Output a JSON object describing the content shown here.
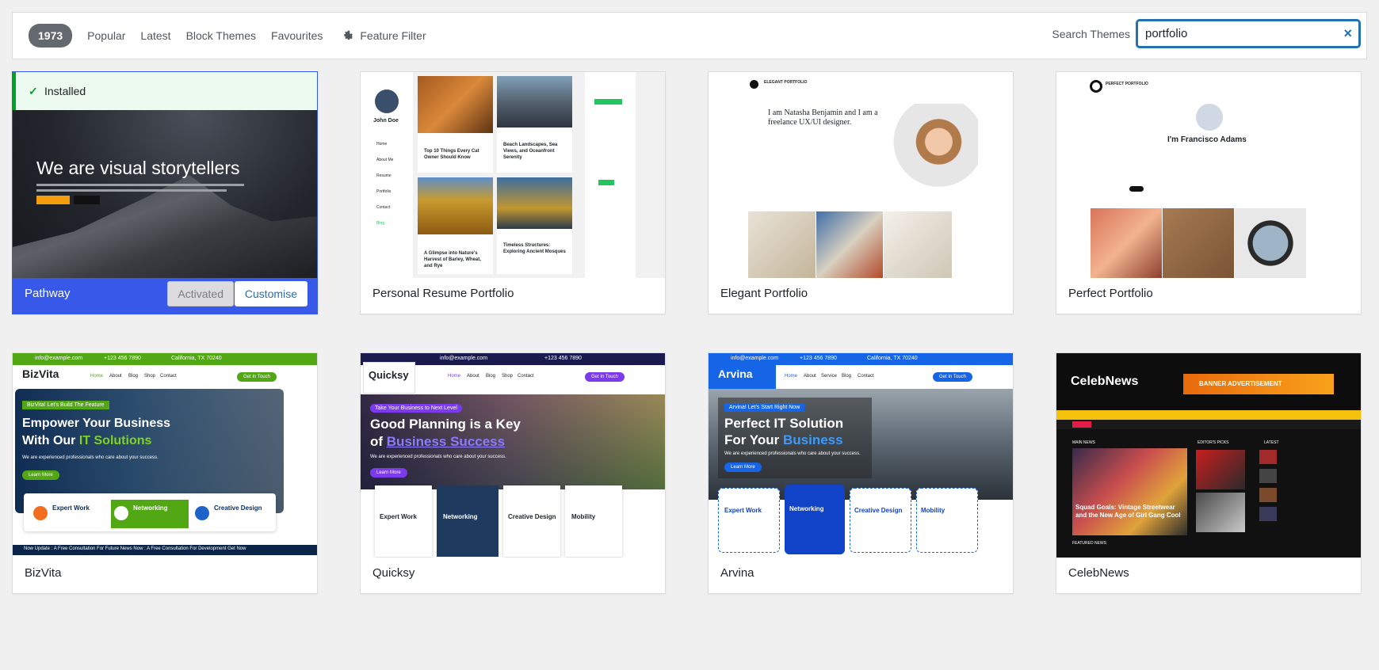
{
  "filter": {
    "count": "1973",
    "tabs": [
      "Popular",
      "Latest",
      "Block Themes",
      "Favourites"
    ],
    "feature_filter": "Feature Filter",
    "search_label": "Search Themes",
    "search_value": "portfolio",
    "clear_icon": "×"
  },
  "themes": [
    {
      "name": "Pathway",
      "installed_label": "Installed",
      "activated_label": "Activated",
      "customise_label": "Customise",
      "preview_headline": "We are visual storytellers"
    },
    {
      "name": "Personal Resume Portfolio",
      "preview": {
        "person": "John Doe",
        "nav": [
          "Home",
          "About Me",
          "Resume",
          "Portfolio",
          "Contact",
          "Blog"
        ],
        "posts": [
          "Top 10 Things Every Cat Owner Should Know",
          "Beach Landscapes, Sea Views, and Oceanfront Serenity",
          "A Glimpse into Nature's Harvest of Barley, Wheat, and Rye",
          "Timeless Structures: Exploring Ancient Mosques"
        ]
      }
    },
    {
      "name": "Elegant Portfolio",
      "preview": {
        "logo": "ELEGANT PORTFOLIO",
        "headline": "I am Natasha Benjamin and I am a freelance UX/UI designer."
      }
    },
    {
      "name": "Perfect Portfolio",
      "preview": {
        "logo": "PERFECT PORTFOLIO",
        "headline": "I'm Francisco Adams"
      }
    },
    {
      "name": "BizVita",
      "preview": {
        "email": "info@example.com",
        "phone": "+123 456 7890",
        "location": "California, TX 70240",
        "logo": "BizVita",
        "nav": [
          "Home",
          "About",
          "Blog",
          "Shop",
          "Contact"
        ],
        "cta": "Get In Touch",
        "tagline": "BizVita!  Let's Build The Feature",
        "headline_1": "Empower Your Business",
        "headline_2": "With Our ",
        "headline_accent": "IT Solutions",
        "sub": "We are experienced professionals who care about your success.",
        "learn": "Learn More",
        "features": [
          "Expert Work",
          "Networking",
          "Creative Design"
        ],
        "ticker": "Now Update : A Free Consultation For Future   News Now : A Free Consultation For Development   Get Now"
      }
    },
    {
      "name": "Quicksy",
      "preview": {
        "email": "info@example.com",
        "phone": "+123 456 7890",
        "logo": "Quicksy",
        "nav": [
          "Home",
          "About",
          "Blog",
          "Shop",
          "Contact"
        ],
        "cta": "Get In Touch",
        "tagline": "Take Your Business to Next Level",
        "headline_1": "Good Planning is a Key",
        "headline_2": "of ",
        "headline_accent": "Business Success",
        "sub": "We are experienced professionals who care about your success.",
        "learn": "Learn More",
        "features": [
          "Expert Work",
          "Networking",
          "Creative Design",
          "Mobility"
        ]
      }
    },
    {
      "name": "Arvina",
      "preview": {
        "email": "info@example.com",
        "phone": "+123 456 7890",
        "location": "California, TX 70240",
        "logo": "Arvina",
        "nav": [
          "Home",
          "About",
          "Service",
          "Blog",
          "Contact"
        ],
        "cta": "Get In Touch",
        "tagline": "Arvina!  Let's Start Right Now",
        "headline_1": "Perfect IT Solution",
        "headline_2": "For Your ",
        "headline_accent": "Business",
        "sub": "We are experienced professionals who care about your success.",
        "learn": "Learn More",
        "features": [
          "Expert Work",
          "Networking",
          "Creative Design",
          "Mobility"
        ]
      }
    },
    {
      "name": "CelebNews",
      "preview": {
        "logo": "CelebNews",
        "banner": "BANNER ADVERTISEMENT",
        "main_news": "MAIN NEWS",
        "editors_picks": "EDITOR'S PICKS",
        "latest": "LATEST",
        "story": "Squad Goals: Vintage Streetwear and the New Age of Girl Gang Cool",
        "featured": "FEATURED NEWS"
      }
    }
  ],
  "colors": {
    "accent": "#2271b1",
    "active_card": "#3858e9",
    "installed_green": "#00a32a"
  }
}
